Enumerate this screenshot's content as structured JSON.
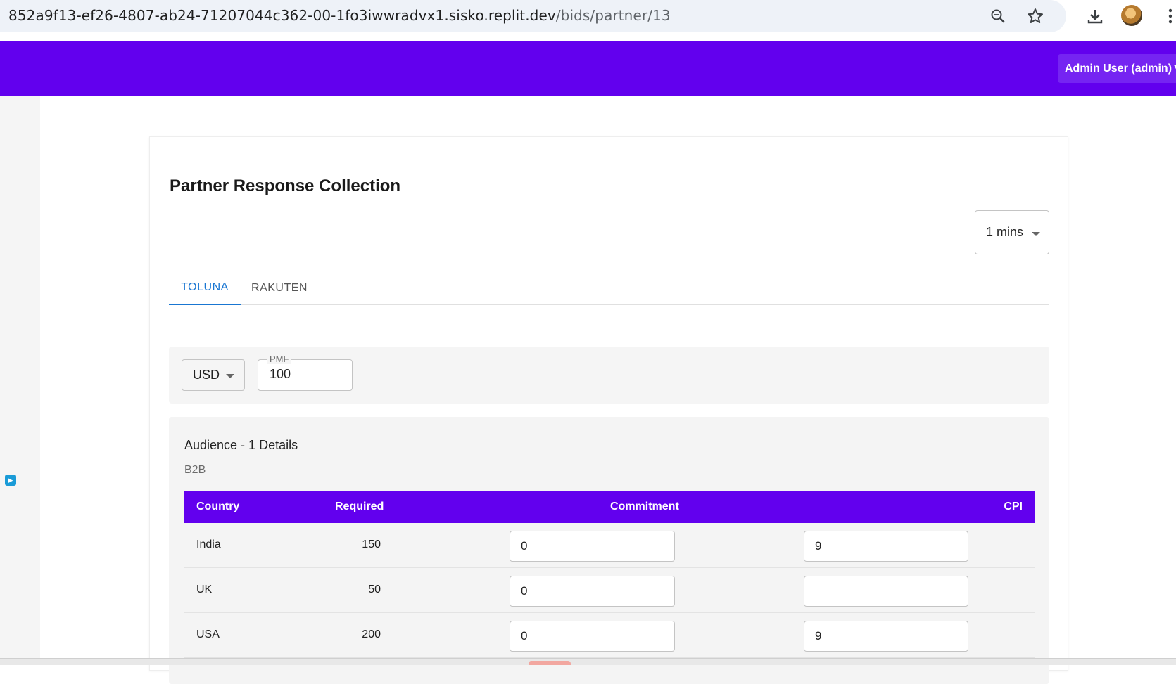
{
  "browser": {
    "url_host": "852a9f13-ef26-4807-ab24-71207044c362-00-1fo3iwwradvx1.sisko.replit.dev",
    "url_path": "/bids/partner/13",
    "zoom_icon": "zoom-icon",
    "bookmark_icon": "star-icon",
    "download_icon": "download-icon",
    "menu_icon": "kebab-menu-icon"
  },
  "header": {
    "user_menu_label": "Admin User (admin)▼",
    "bg_color": "#6200ee"
  },
  "page": {
    "title": "Partner Response Collection",
    "interval_select": "1 mins",
    "tabs": [
      {
        "label": "TOLUNA",
        "active": true
      },
      {
        "label": "RAKUTEN",
        "active": false
      }
    ],
    "currency_select": "USD",
    "pmf": {
      "label": "PMF",
      "value": "100"
    }
  },
  "audience": {
    "title": "Audience - 1 Details",
    "subtitle": "B2B",
    "columns": [
      "Country",
      "Required",
      "Commitment",
      "CPI"
    ],
    "rows": [
      {
        "country": "India",
        "required": "150",
        "commitment": "0",
        "cpi": "9"
      },
      {
        "country": "UK",
        "required": "50",
        "commitment": "0",
        "cpi": ""
      },
      {
        "country": "USA",
        "required": "200",
        "commitment": "0",
        "cpi": "9"
      }
    ]
  },
  "colors": {
    "accent": "#6200ee",
    "tab_active": "#1976d2"
  }
}
